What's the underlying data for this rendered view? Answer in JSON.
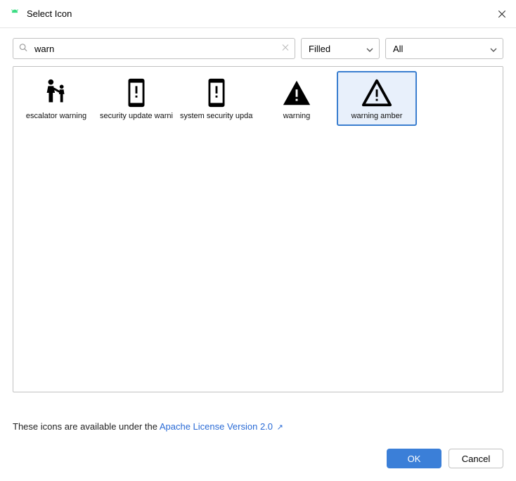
{
  "window": {
    "title": "Select Icon"
  },
  "search": {
    "value": "warn"
  },
  "dropdowns": {
    "style": "Filled",
    "category": "All"
  },
  "icons": [
    {
      "id": "escalator-warning",
      "label": "escalator warning",
      "glyph": "escalator-warning",
      "selected": false
    },
    {
      "id": "security-update-warning",
      "label": "security update warni",
      "glyph": "security-update-warning",
      "selected": false
    },
    {
      "id": "system-security-update",
      "label": "system security update",
      "glyph": "system-security-update",
      "selected": false
    },
    {
      "id": "warning",
      "label": "warning",
      "glyph": "warning",
      "selected": false
    },
    {
      "id": "warning-amber",
      "label": "warning amber",
      "glyph": "warning-amber",
      "selected": true
    }
  ],
  "footer": {
    "license_prefix": "These icons are available under the ",
    "license_link_text": "Apache License Version 2.0"
  },
  "buttons": {
    "ok": "OK",
    "cancel": "Cancel"
  }
}
